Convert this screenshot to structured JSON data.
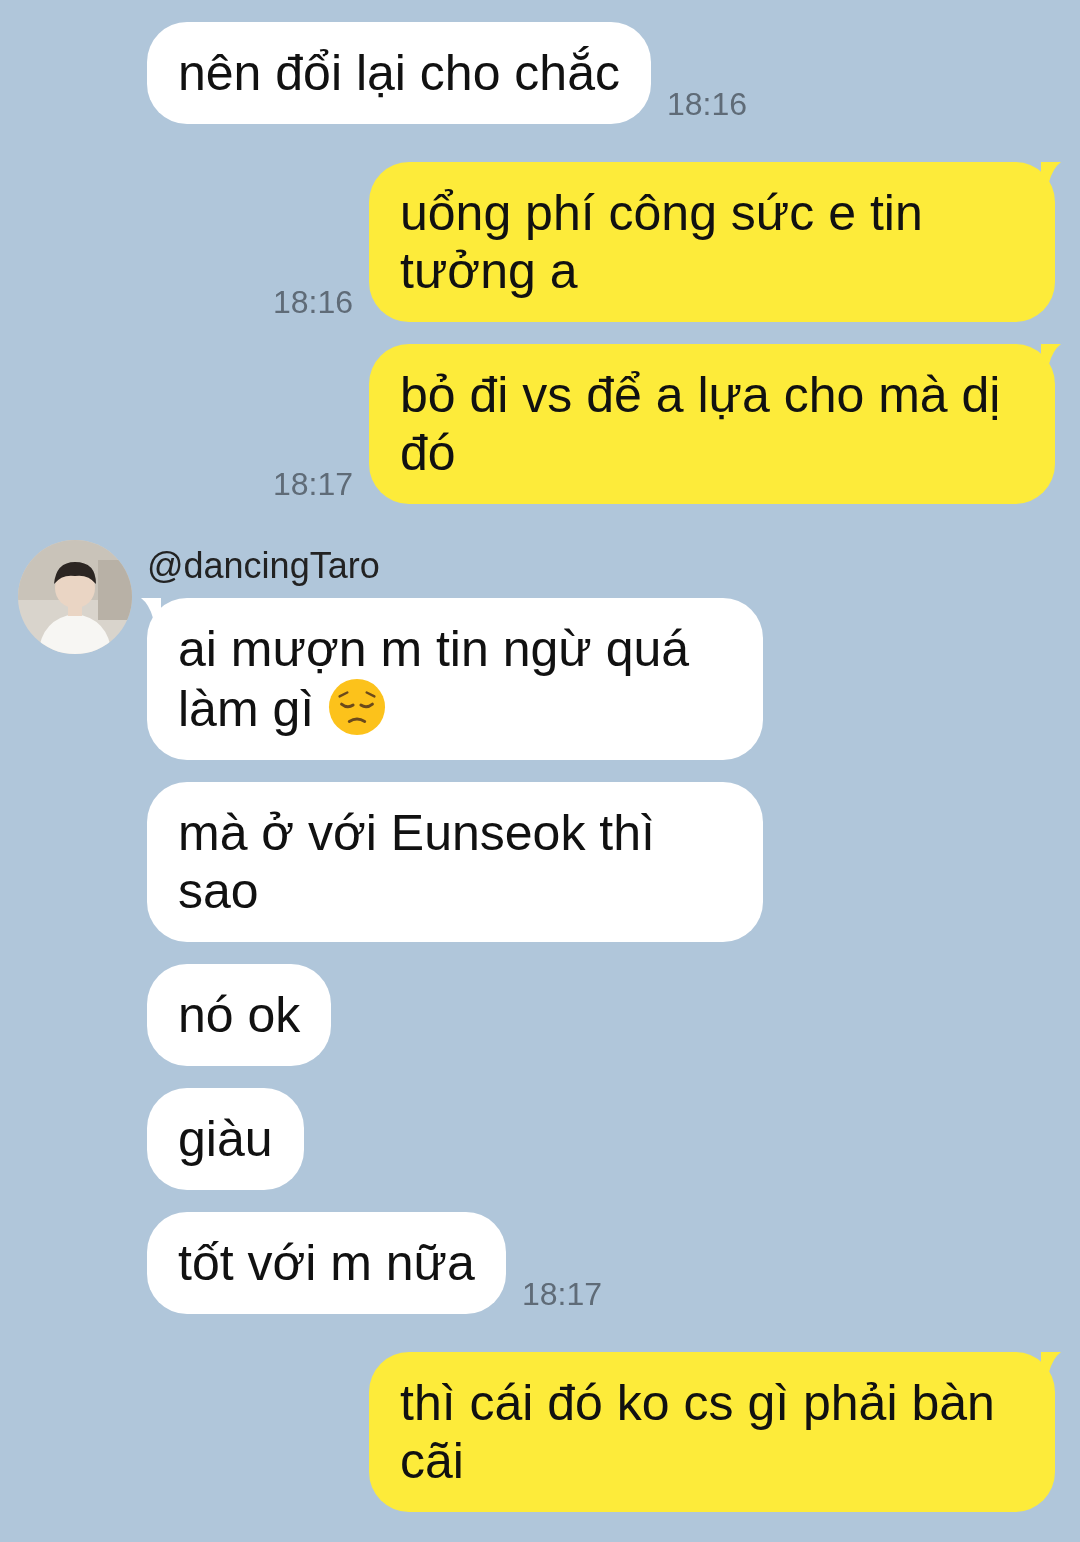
{
  "chat": [
    {
      "kind": "incoming",
      "text": "nên đổi lại cho chắc",
      "time": "18:16",
      "tail": false
    },
    {
      "kind": "outgoing",
      "text": "uổng phí công sức e tin tưởng a",
      "time": "18:16",
      "tail": true
    },
    {
      "kind": "outgoing",
      "text": "bỏ đi vs để a lựa cho mà dị đó",
      "time": "18:17",
      "tail": true
    },
    {
      "kind": "group",
      "sender": "@dancingTaro",
      "messages": [
        {
          "text": "ai mượn m tin ngừ quá làm gì",
          "emoji": true,
          "tail": true
        },
        {
          "text": "mà ở với Eunseok thì sao",
          "tail": false
        },
        {
          "text": "nó ok",
          "tail": false
        },
        {
          "text": "giàu",
          "tail": false
        },
        {
          "text": "tốt với m nữa",
          "time": "18:17",
          "tail": false
        }
      ]
    },
    {
      "kind": "outgoing",
      "text": "thì cái đó ko cs gì phải bàn cãi",
      "tail": true
    }
  ]
}
